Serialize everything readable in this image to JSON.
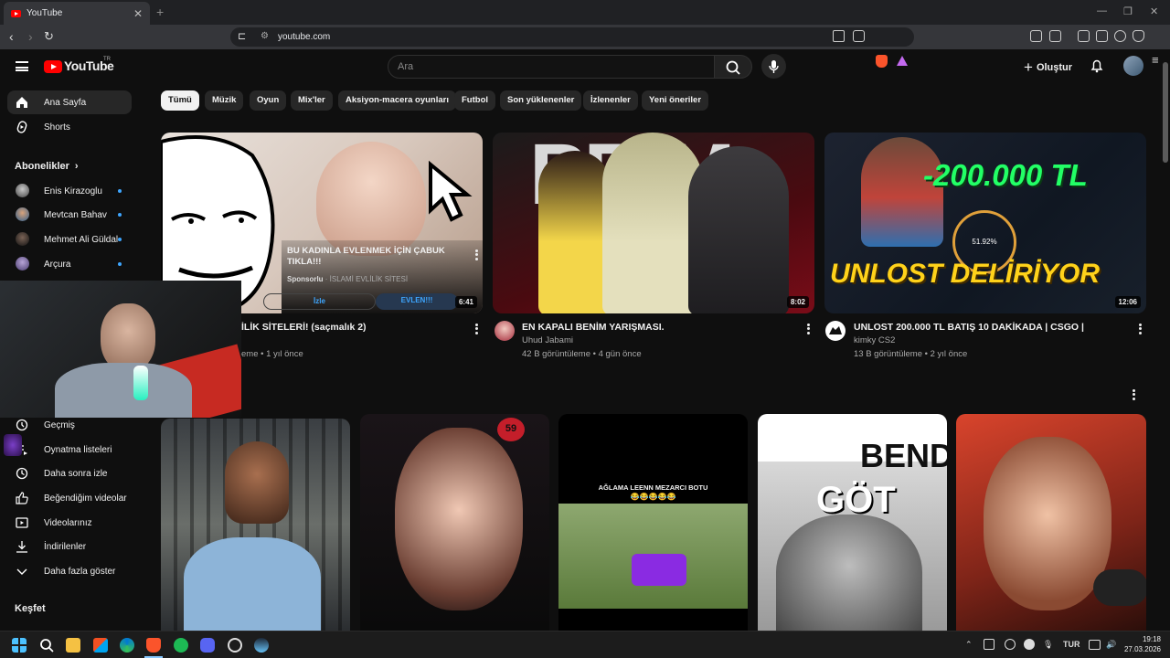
{
  "browser": {
    "tab_title": "YouTube",
    "url": "youtube.com"
  },
  "header": {
    "logo_text": "YouTube",
    "country_code": "TR",
    "search_placeholder": "Ara",
    "create_label": "Oluştur"
  },
  "sidebar": {
    "main": [
      {
        "label": "Ana Sayfa",
        "icon": "home-icon"
      },
      {
        "label": "Shorts",
        "icon": "shorts-icon"
      }
    ],
    "subs_heading": "Abonelikler",
    "subscriptions": [
      {
        "label": "Enis Kirazoglu"
      },
      {
        "label": "Mevtcan Bahav"
      },
      {
        "label": "Mehmet Ali Güldal"
      },
      {
        "label": "Arçura"
      }
    ],
    "you_items": [
      {
        "label": "Geçmiş",
        "icon": "history-icon"
      },
      {
        "label": "Oynatma listeleri",
        "icon": "playlist-icon"
      },
      {
        "label": "Daha sonra izle",
        "icon": "clock-icon"
      },
      {
        "label": "Beğendiğim videolar",
        "icon": "like-icon"
      },
      {
        "label": "Videolarınız",
        "icon": "video-icon"
      },
      {
        "label": "İndirilenler",
        "icon": "download-icon"
      },
      {
        "label": "Daha fazla göster",
        "icon": "chevron-down-icon"
      }
    ],
    "explore_heading": "Keşfet"
  },
  "chips": [
    "Tümü",
    "Müzik",
    "Oyun",
    "Mix'ler",
    "Aksiyon-macera oyunları",
    "Futbol",
    "Son yüklenenler",
    "İzlenenler",
    "Yeni öneriler"
  ],
  "videos": [
    {
      "ad_title": "BU KADINLA EVLENMEK İÇİN ÇABUK TIKLA!!!",
      "ad_sponsor": "Sponsorlu",
      "ad_site": "İSLAMİ EVLİLİK SİTESİ",
      "ad_watch": "İzle",
      "ad_cta": "EVLEN!!!",
      "duration": "6:41",
      "title": "İLİK SİTELERİ! (saçmalık 2)",
      "meta": "eme • 1 yıl önce"
    },
    {
      "thumb_text": "PRIM",
      "duration": "8:02",
      "title": "EN KAPALI BENİM YARIŞMASI.",
      "channel": "Uhud Jabami",
      "meta": "42 B görüntüleme • 4 gün önce"
    },
    {
      "thumb_text_top": "-200.000 TL",
      "thumb_text_bottom": "UNLOST DELİRİYOR",
      "thumb_stat": "51.92%",
      "duration": "12:06",
      "title": "UNLOST 200.000 TL BATIŞ 10 DAKİKADA | CSGO |",
      "channel": "kimky CS2",
      "meta": "13 B görüntüleme • 2 yıl önce"
    }
  ],
  "shorts": [
    {
      "thumb_text": ""
    },
    {
      "thumb_text": "59"
    },
    {
      "thumb_text": "AĞLAMA LEENN MEZARCI BOTU",
      "thumb_emoji": "😂😂😂😂😂"
    },
    {
      "thumb_text": "BENDE",
      "thumb_text2": "GÖT"
    },
    {
      "thumb_text": ""
    }
  ],
  "taskbar": {
    "lang": "TUR",
    "time": "19:18",
    "date": "27.03.2026"
  },
  "colors": {
    "bg": "#0f0f0f",
    "accent_red": "#ff0000",
    "link_blue": "#3ea6ff",
    "neon_green": "#22ff66"
  }
}
